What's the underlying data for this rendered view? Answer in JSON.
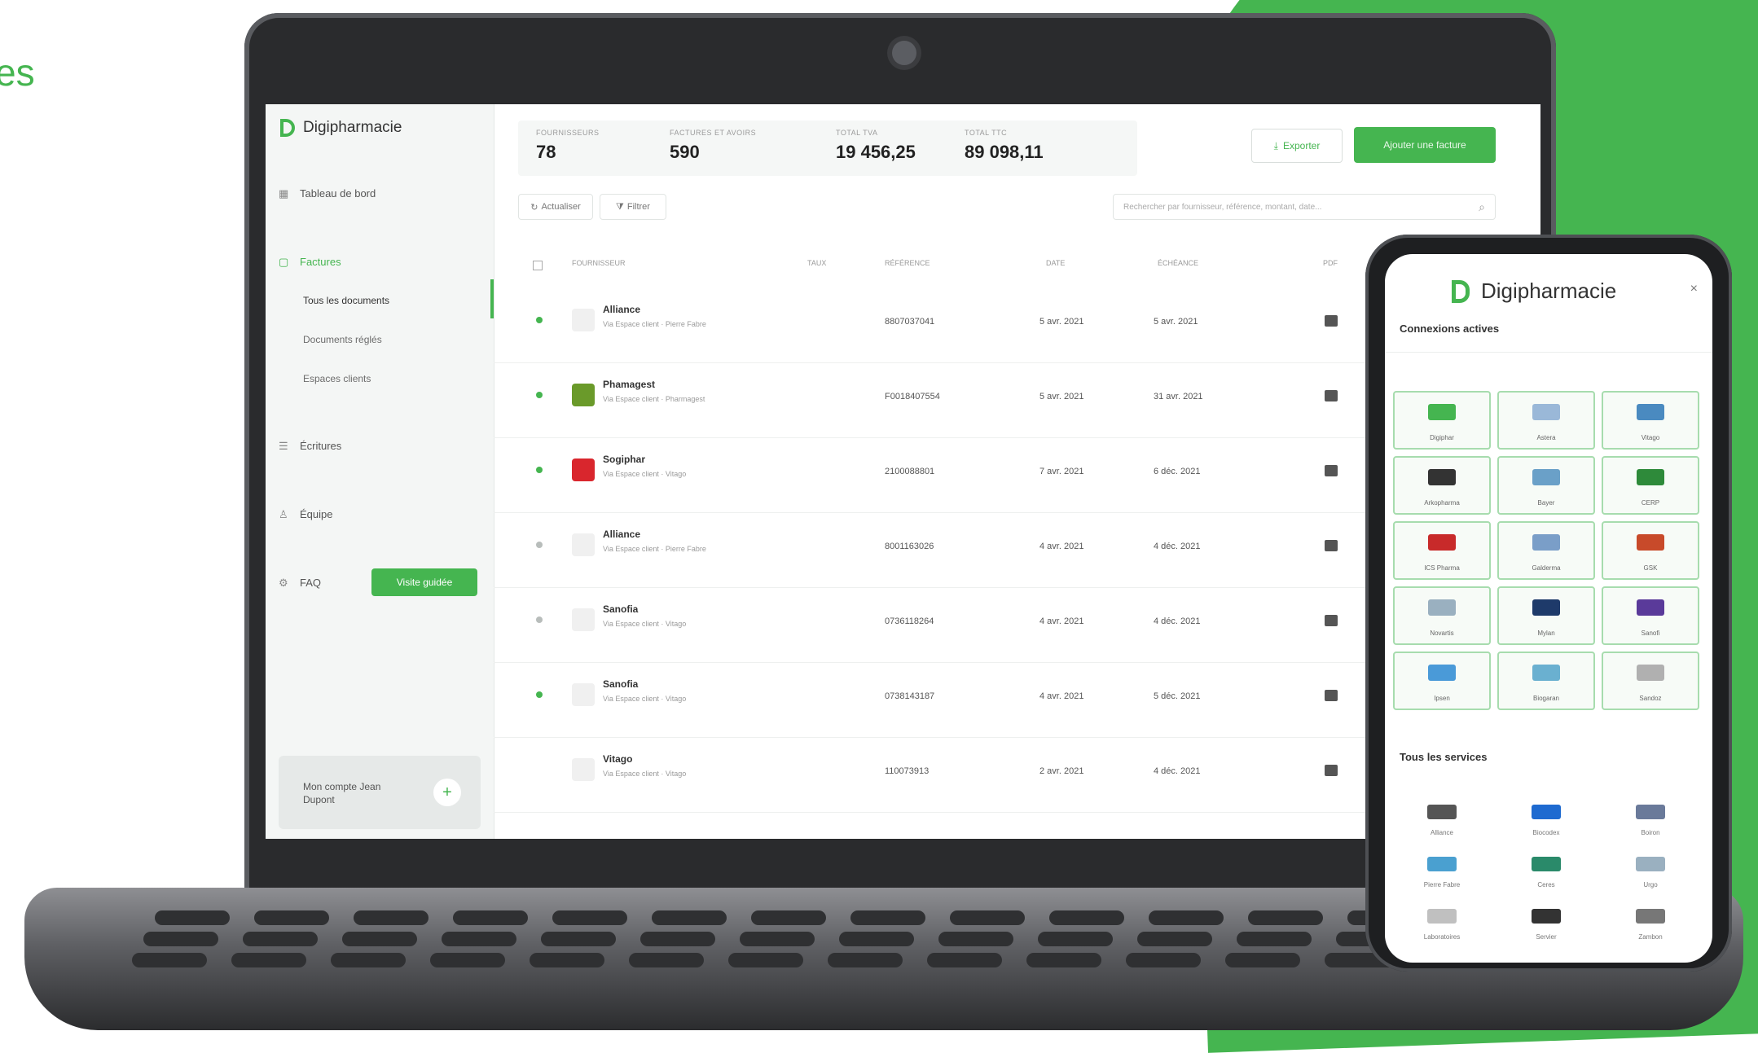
{
  "corner_text": "es",
  "app": {
    "name": "Digipharmacie",
    "sidebar": {
      "items": [
        {
          "label": "Tableau de bord",
          "icon": "dashboard-icon"
        },
        {
          "label": "Factures",
          "icon": "invoice-icon"
        },
        {
          "label": "Écritures",
          "icon": "ledger-icon"
        },
        {
          "label": "Équipe",
          "icon": "team-icon"
        },
        {
          "label": "FAQ",
          "icon": "help-icon"
        }
      ],
      "sub_items": [
        "Tous les documents",
        "Documents réglés",
        "Espaces clients"
      ],
      "promo_button": "Visite guidée",
      "account_name": "Mon compte Jean Dupont"
    },
    "stats": [
      {
        "label": "FOURNISSEURS",
        "value": "78"
      },
      {
        "label": "FACTURES ET AVOIRS",
        "value": "590"
      },
      {
        "label": "TOTAL TVA",
        "value": "19 456,25"
      },
      {
        "label": "TOTAL TTC",
        "value": "89 098,11"
      }
    ],
    "export_button": "Exporter",
    "add_button": "Ajouter une facture",
    "filters": [
      "Actualiser",
      "Filtrer"
    ],
    "search_placeholder": "Rechercher par fournisseur, référence, montant, date...",
    "columns": [
      "FOURNISSEUR",
      "TAUX",
      "RÉFÉRENCE",
      "DATE",
      "ÉCHÉANCE",
      "PDF"
    ],
    "rows": [
      {
        "supplier": "Alliance",
        "meta": "Via Espace client · Pierre Fabre",
        "ref": "8807037041",
        "date": "5 avr. 2021",
        "due": "5 avr. 2021",
        "logo_color": "#f0f0f0",
        "dot": "on"
      },
      {
        "supplier": "Phamagest",
        "meta": "Via Espace client · Pharmagest",
        "ref": "F0018407554",
        "date": "5 avr. 2021",
        "due": "31 avr. 2021",
        "logo_color": "#6a9a2a",
        "dot": "on"
      },
      {
        "supplier": "Sogiphar",
        "meta": "Via Espace client · Vitago",
        "ref": "2100088801",
        "date": "7 avr. 2021",
        "due": "6 déc. 2021",
        "logo_color": "#d9262d",
        "dot": "on"
      },
      {
        "supplier": "Alliance",
        "meta": "Via Espace client · Pierre Fabre",
        "ref": "8001163026",
        "date": "4 avr. 2021",
        "due": "4 déc. 2021",
        "logo_color": "#f0f0f0",
        "dot": "off"
      },
      {
        "supplier": "Sanofia",
        "meta": "Via Espace client · Vitago",
        "ref": "0736118264",
        "date": "4 avr. 2021",
        "due": "4 déc. 2021",
        "logo_color": "#f0f0f0",
        "dot": "off"
      },
      {
        "supplier": "Sanofia",
        "meta": "Via Espace client · Vitago",
        "ref": "0738143187",
        "date": "4 avr. 2021",
        "due": "5 déc. 2021",
        "logo_color": "#f0f0f0",
        "dot": "on"
      },
      {
        "supplier": "Vitago",
        "meta": "Via Espace client · Vitago",
        "ref": "110073913",
        "date": "2 avr. 2021",
        "due": "4 déc. 2021",
        "logo_color": "#f0f0f0",
        "dot": "none"
      }
    ],
    "accent_color": "#45b550"
  },
  "phone": {
    "title": "Digipharmacie",
    "section_active": "Connexions actives",
    "tiles": [
      {
        "label": "Digiphar",
        "color": "#45b550"
      },
      {
        "label": "Astera",
        "color": "#9ab8d8"
      },
      {
        "label": "Vitago",
        "color": "#4a8ac0"
      },
      {
        "label": "Arkopharma",
        "color": "#333333"
      },
      {
        "label": "Bayer",
        "color": "#6aa0c8"
      },
      {
        "label": "CERP",
        "color": "#2e8a3a"
      },
      {
        "label": "ICS Pharma",
        "color": "#c82a2a"
      },
      {
        "label": "Galderma",
        "color": "#7a9ec8"
      },
      {
        "label": "GSK",
        "color": "#c84a2a"
      },
      {
        "label": "Novartis",
        "color": "#9ab0c0"
      },
      {
        "label": "Mylan",
        "color": "#1e3a6a"
      },
      {
        "label": "Sanofi",
        "color": "#5a3a9a"
      },
      {
        "label": "Ipsen",
        "color": "#4a9ad8"
      },
      {
        "label": "Biogaran",
        "color": "#6ab0d0"
      },
      {
        "label": "Sandoz",
        "color": "#b0b0b0"
      }
    ],
    "section_all": "Tous les services",
    "services": [
      {
        "label": "Alliance",
        "color": "#555555"
      },
      {
        "label": "Biocodex",
        "color": "#1e6ad0"
      },
      {
        "label": "Boiron",
        "color": "#6a7a9a"
      },
      {
        "label": "Pierre Fabre",
        "color": "#4aa0d0"
      },
      {
        "label": "Ceres",
        "color": "#2a8a6a"
      },
      {
        "label": "Urgo",
        "color": "#9ab0c0"
      },
      {
        "label": "Laboratoires",
        "color": "#c0c0c0"
      },
      {
        "label": "Servier",
        "color": "#333333"
      },
      {
        "label": "Zambon",
        "color": "#777777"
      }
    ]
  }
}
